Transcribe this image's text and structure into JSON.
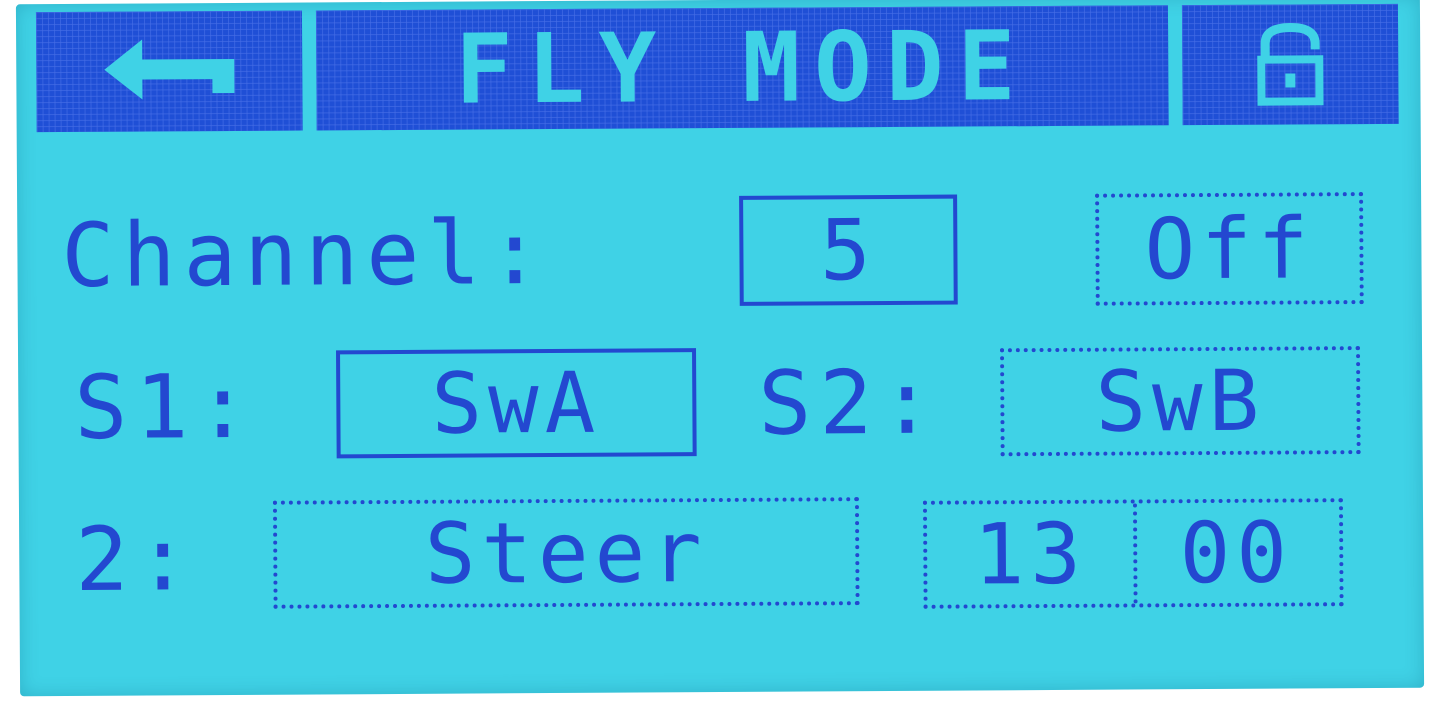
{
  "header": {
    "back_icon": "back-arrow-icon",
    "title": "FLY MODE",
    "lock_icon": "lock-icon"
  },
  "channel": {
    "label": "Channel:",
    "value": "5",
    "state": "Off"
  },
  "switches": {
    "s1_label": "S1:",
    "s1_value": "SwA",
    "s2_label": "S2:",
    "s2_value": "SwB"
  },
  "mode": {
    "label": "2:",
    "value": "Steer",
    "num_left": "13",
    "num_right": "00"
  },
  "colors": {
    "background": "#3fd2e6",
    "ink": "#2348d0",
    "header": "#1f4fd6"
  }
}
